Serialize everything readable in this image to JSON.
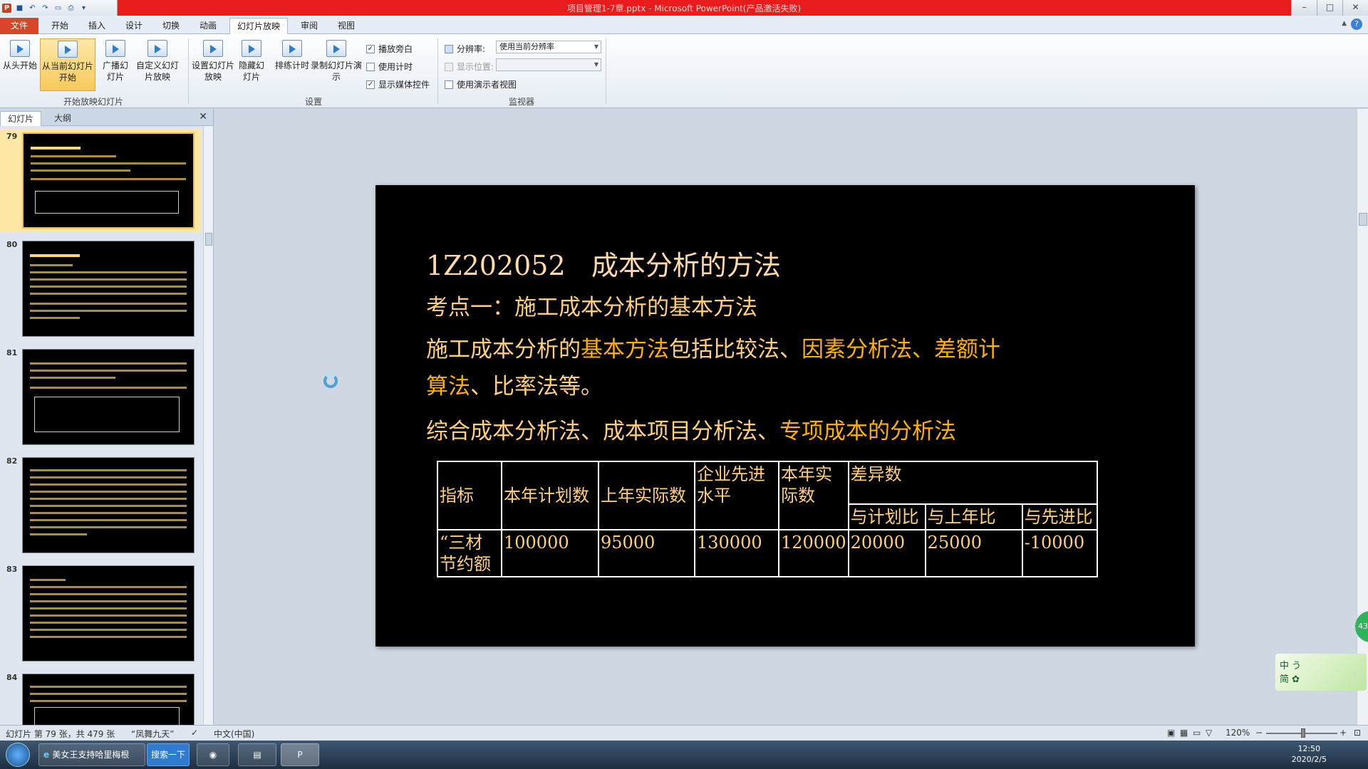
{
  "window": {
    "title": "项目管理1-7章.pptx - Microsoft PowerPoint(产品激活失败)",
    "minimize": "–",
    "maximize": "□",
    "close": "✕"
  },
  "ribbon_tabs": [
    "文件",
    "开始",
    "插入",
    "设计",
    "切换",
    "动画",
    "幻灯片放映",
    "审阅",
    "视图"
  ],
  "ribbon": {
    "btn_from_start": "从头开始",
    "btn_from_current": "从当前幻灯片开始",
    "btn_broadcast": "广播幻灯片",
    "btn_custom": "自定义幻灯片放映",
    "group_start": "开始放映幻灯片",
    "btn_setup": "设置幻灯片放映",
    "btn_hide": "隐藏幻灯片",
    "btn_rehearse": "排练计时",
    "btn_record": "录制幻灯片演示",
    "chk_narration": "播放旁白",
    "chk_timings": "使用计时",
    "chk_media": "显示媒体控件",
    "group_setup": "设置",
    "resolution_label": "分辨率:",
    "resolution_value": "使用当前分辨率",
    "show_on_label": "显示位置:",
    "presenter_view": "使用演示者视图",
    "group_monitors": "监视器"
  },
  "left_pane": {
    "tab_slides": "幻灯片",
    "tab_outline": "大纲",
    "close": "✕",
    "thumb_numbers": [
      "79",
      "80",
      "81",
      "82",
      "83",
      "84"
    ]
  },
  "slide": {
    "title": "1Z202052   成本分析的方法",
    "subtitle": "考点一：施工成本分析的基本方法",
    "para1_a": "施工成本分析的",
    "para1_b": "基本方法",
    "para1_c": "包括比较法、",
    "para1_d": "因素分析法、差额计算法",
    "para1_e": "、比率法等。",
    "para2_a": "综合成本分析法、成本项目分析法、",
    "para2_b": "专项成本的分析法",
    "table": {
      "h_indicator": "指标",
      "h_plan": "本年计划数",
      "h_last": "上年实际数",
      "h_adv": "企业先进水平",
      "h_actual": "本年实际数",
      "h_diff": "差异数",
      "h_vs_plan": "与计划比",
      "h_vs_last": "与上年比",
      "h_vs_adv": "与先进比",
      "row_label": "“三材节约额",
      "row_values": [
        "100000",
        "95000",
        "130000",
        "120000",
        "20000",
        "25000",
        "-10000"
      ]
    }
  },
  "status": {
    "slide_info": "幻灯片 第 79 张，共 479 张",
    "theme": "“凤舞九天”",
    "lang": "中文(中国)",
    "zoom": "120%",
    "zoom_minus": "−",
    "zoom_plus": "+"
  },
  "taskbar": {
    "ie_item": "美女王支持哈里梅根",
    "search_btn": "搜索一下",
    "time": "12:50",
    "date": "2020/2/5"
  },
  "widget": {
    "text1": "中 う",
    "text2": "简 ✿"
  },
  "badge": "43"
}
